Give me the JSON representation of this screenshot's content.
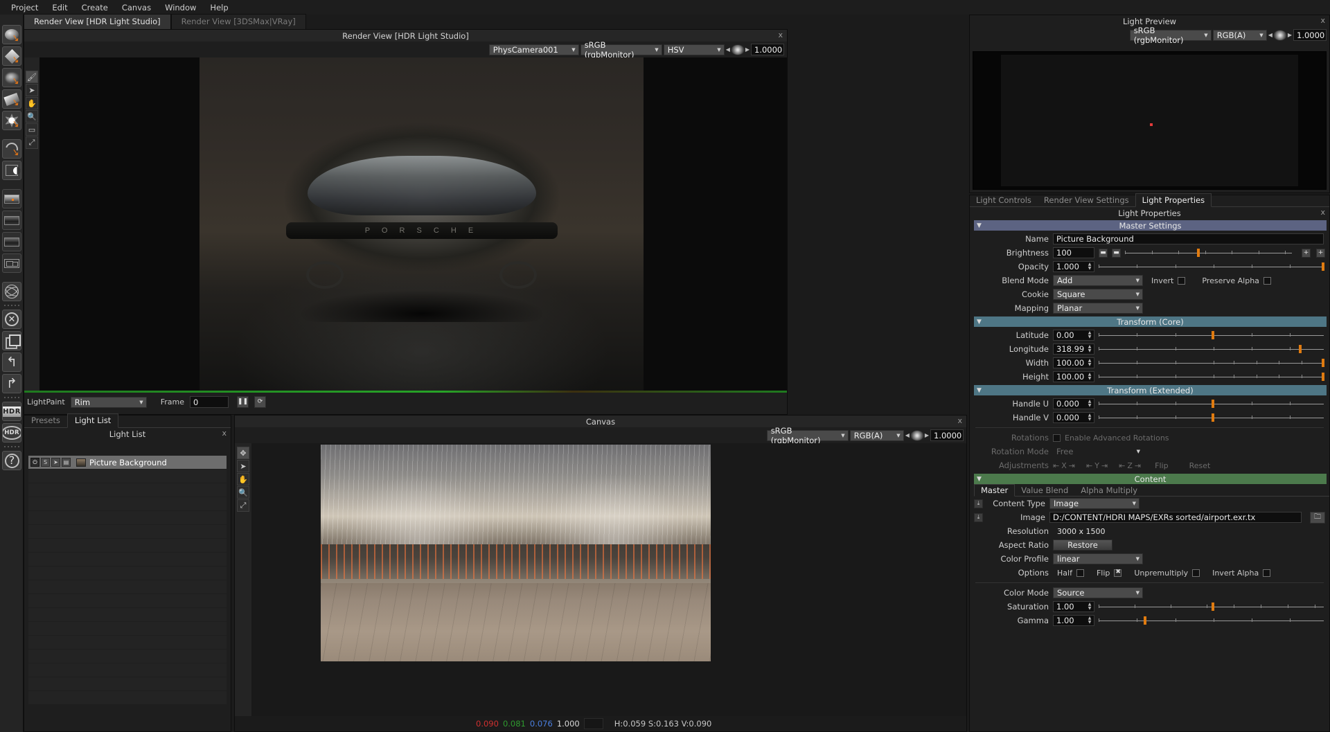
{
  "menu": {
    "items": [
      "Project",
      "Edit",
      "Create",
      "Canvas",
      "Window",
      "Help"
    ]
  },
  "view_tabs": [
    {
      "label": "Render View [HDR Light Studio]",
      "active": true
    },
    {
      "label": "Render View [3DSMax|VRay]",
      "active": false
    }
  ],
  "render_view": {
    "title": "Render View [HDR Light Studio]",
    "close": "x",
    "camera": "PhysCamera001",
    "color_space": "sRGB (rgbMonitor)",
    "channel": "HSV",
    "exposure": "1.0000",
    "car_badge": "P O R S C H E",
    "lightpaint_label": "LightPaint",
    "lightpaint_value": "Rim",
    "frame_label": "Frame",
    "frame_value": "0",
    "pause_icon": "pause-icon",
    "refresh_icon": "refresh-icon"
  },
  "light_list": {
    "tabs": [
      {
        "label": "Presets",
        "active": false
      },
      {
        "label": "Light List",
        "active": true
      }
    ],
    "title": "Light List",
    "close": "x",
    "rows": [
      {
        "name": "Picture Background",
        "selected": true
      }
    ]
  },
  "canvas": {
    "title": "Canvas",
    "close": "x",
    "color_space": "sRGB (rgbMonitor)",
    "channel": "RGB(A)",
    "exposure": "1.0000",
    "pixel_r": "0.090",
    "pixel_g": "0.081",
    "pixel_b": "0.076",
    "pixel_a": "1.000",
    "hsv": "H:0.059 S:0.163 V:0.090"
  },
  "light_preview": {
    "title": "Light Preview",
    "close": "x",
    "color_space": "sRGB (rgbMonitor)",
    "channel": "RGB(A)",
    "exposure": "1.0000"
  },
  "properties": {
    "tabs": [
      {
        "label": "Light Controls",
        "active": false
      },
      {
        "label": "Render View Settings",
        "active": false
      },
      {
        "label": "Light Properties",
        "active": true
      }
    ],
    "title": "Light Properties",
    "close": "x",
    "master_settings": {
      "header": "Master Settings",
      "name_label": "Name",
      "name_value": "Picture Background",
      "brightness_label": "Brightness",
      "brightness_value": "100",
      "brightness_knob_pct": 43,
      "opacity_label": "Opacity",
      "opacity_value": "1.000",
      "opacity_knob_pct": 100,
      "blend_mode_label": "Blend Mode",
      "blend_mode_value": "Add",
      "invert_label": "Invert",
      "invert_checked": false,
      "preserve_alpha_label": "Preserve Alpha",
      "preserve_alpha_checked": false,
      "cookie_label": "Cookie",
      "cookie_value": "Square",
      "mapping_label": "Mapping",
      "mapping_value": "Planar"
    },
    "transform_core": {
      "header": "Transform (Core)",
      "fields": [
        {
          "label": "Latitude",
          "value": "0.00",
          "knob_pct": 50
        },
        {
          "label": "Longitude",
          "value": "318.99",
          "knob_pct": 89
        },
        {
          "label": "Width",
          "value": "100.00",
          "knob_pct": 100
        },
        {
          "label": "Height",
          "value": "100.00",
          "knob_pct": 100
        }
      ]
    },
    "transform_extended": {
      "header": "Transform (Extended)",
      "fields": [
        {
          "label": "Handle U",
          "value": "0.000",
          "knob_pct": 50
        },
        {
          "label": "Handle V",
          "value": "0.000",
          "knob_pct": 50
        }
      ],
      "rotations_label": "Rotations",
      "enable_advanced_rotations": "Enable Advanced Rotations",
      "enable_advanced_checked": false,
      "rotation_mode_label": "Rotation Mode",
      "rotation_mode_value": "Free",
      "adjustments_label": "Adjustments",
      "axis_x": "X",
      "axis_y": "Y",
      "axis_z": "Z",
      "flip_label": "Flip",
      "reset_label": "Reset"
    },
    "content": {
      "header": "Content",
      "tabs": [
        {
          "label": "Master",
          "active": true
        },
        {
          "label": "Value Blend",
          "active": false
        },
        {
          "label": "Alpha Multiply",
          "active": false
        }
      ],
      "content_type_label": "Content Type",
      "content_type_value": "Image",
      "image_label": "Image",
      "image_value": "D:/CONTENT/HDRI MAPS/EXRs sorted/airport.exr.tx",
      "resolution_label": "Resolution",
      "resolution_value": "3000 x 1500",
      "aspect_ratio_label": "Aspect Ratio",
      "restore_label": "Restore",
      "color_profile_label": "Color Profile",
      "color_profile_value": "linear",
      "options_label": "Options",
      "half_label": "Half",
      "half_checked": false,
      "flip_label": "Flip",
      "flip_checked": true,
      "unpremultiply_label": "Unpremultiply",
      "unpremultiply_checked": false,
      "invert_alpha_label": "Invert Alpha",
      "invert_alpha_checked": false,
      "color_mode_label": "Color Mode",
      "color_mode_value": "Source",
      "saturation_label": "Saturation",
      "saturation_value": "1.00",
      "saturation_knob_pct": 50,
      "gamma_label": "Gamma",
      "gamma_value": "1.00",
      "gamma_knob_pct": 20
    }
  },
  "colors": {
    "accent_orange": "#e07b10",
    "master_bar": "#5c6382",
    "transform_bar": "#4e7685",
    "content_bar": "#4c7a4c",
    "green_progress": "#27a327"
  }
}
